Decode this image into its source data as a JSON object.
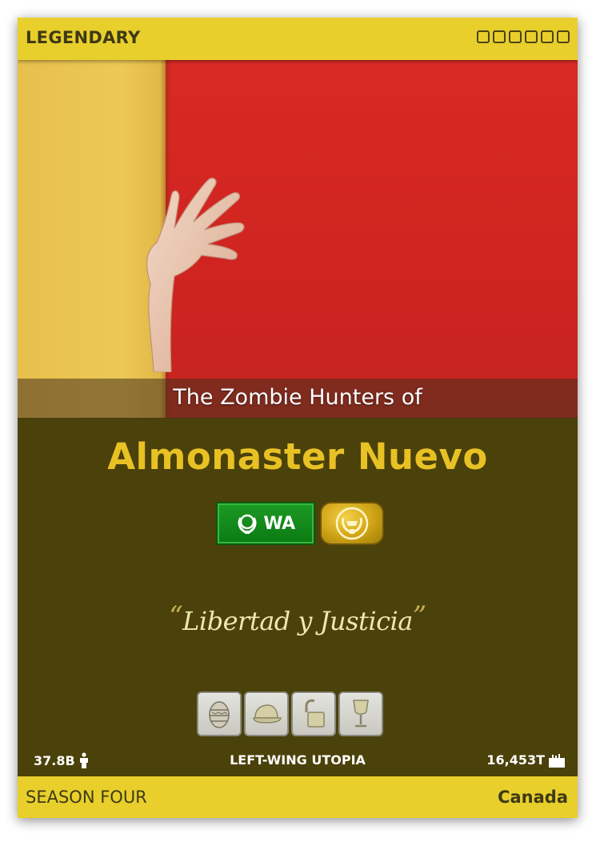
{
  "card": {
    "rarity": "LEGENDARY",
    "rarity_box_count": 6,
    "pretitle": "The Zombie Hunters of",
    "name": "Almonaster Nuevo",
    "badges": [
      {
        "label": "WA",
        "icon": "laurel-icon",
        "color": "#1c9a25"
      },
      {
        "icon": "laurel-seal-icon",
        "color": "#d2a618"
      }
    ],
    "motto": "Libertad y Justicia",
    "motto_open_quote": "“",
    "motto_close_quote": "”",
    "trophies": [
      {
        "icon": "easter-egg-icon"
      },
      {
        "icon": "cap-icon"
      },
      {
        "icon": "unlocked-padlock-icon"
      },
      {
        "icon": "wine-glass-icon"
      }
    ],
    "population": "37.8B",
    "population_icon": "person-icon",
    "category": "LEFT-WING UTOPIA",
    "gdp": "16,453T",
    "gdp_icon": "factory-icon",
    "season": "SEASON FOUR",
    "region": "Canada",
    "flag_colors": {
      "hoist": "#edc856",
      "fly": "#d82a22"
    },
    "accent_color": "#e8cf2c",
    "body_color": "#4b410a"
  }
}
